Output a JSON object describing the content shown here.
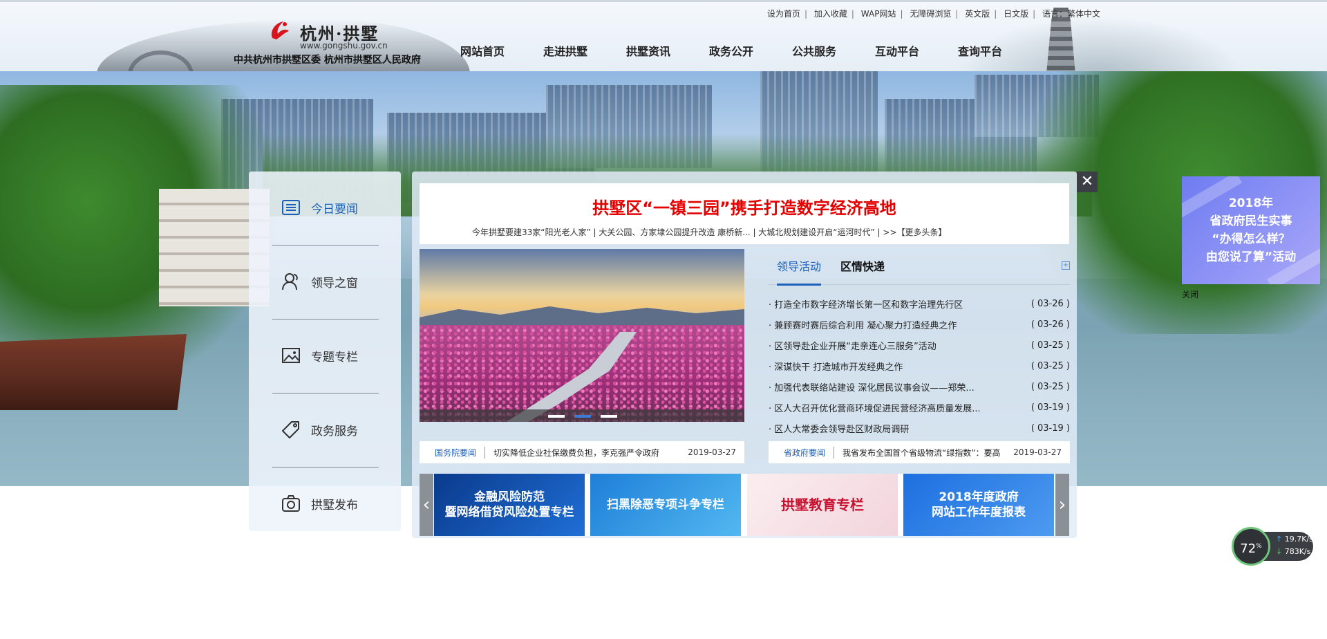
{
  "logo": {
    "title": "杭州·拱墅",
    "url": "www.gongshu.gov.cn",
    "org": "中共杭州市拱墅区委  杭州市拱墅区人民政府"
  },
  "toplinks": [
    "设为首页",
    "加入收藏",
    "WAP网站",
    "无障碍浏览",
    "英文版",
    "日文版",
    "语言：繁体中文"
  ],
  "nav": [
    "网站首页",
    "走进拱墅",
    "拱墅资讯",
    "政务公开",
    "公共服务",
    "互动平台",
    "查询平台"
  ],
  "sidebar": {
    "items": [
      {
        "label": "今日要闻",
        "icon": "news-list-icon"
      },
      {
        "label": "领导之窗",
        "icon": "people-icon"
      },
      {
        "label": "专题专栏",
        "icon": "image-icon"
      },
      {
        "label": "政务服务",
        "icon": "tag-icon"
      },
      {
        "label": "拱墅发布",
        "icon": "camera-icon"
      }
    ]
  },
  "headline": {
    "title": "拱墅区“一镇三园”携手打造数字经济高地",
    "subnews": "今年拱墅要建33家“阳光老人家”  | 大关公园、方家埭公园提升改造 康桥新...  | 大城北规划建设开启“运河时代”  | >>【更多头条】"
  },
  "tabs": {
    "active": "领导活动",
    "other": "区情快递"
  },
  "news": [
    {
      "title": "· 打造全市数字经济增长第一区和数字治理先行区",
      "date": "( 03-26 )"
    },
    {
      "title": "· 兼顾赛时赛后综合利用 凝心聚力打造经典之作",
      "date": "( 03-26 )"
    },
    {
      "title": "· 区领导赴企业开展“走亲连心三服务”活动",
      "date": "( 03-25 )"
    },
    {
      "title": "· 深谋快干 打造城市开发经典之作",
      "date": "( 03-25 )"
    },
    {
      "title": "· 加强代表联络站建设 深化居民议事会议——郑荣...",
      "date": "( 03-25 )"
    },
    {
      "title": "· 区人大召开优化营商环境促进民营经济高质量发展...",
      "date": "( 03-19 )"
    },
    {
      "title": "· 区人大常委会领导赴区财政局调研",
      "date": "( 03-19 )"
    }
  ],
  "tickers": [
    {
      "source": "国务院要闻",
      "text": "切实降低企业社保缴费负担，李克强严令政府",
      "date": "2019-03-27"
    },
    {
      "source": "省政府要闻",
      "text": "我省发布全国首个省级物流“绿指数”：要高",
      "date": "2019-03-27"
    }
  ],
  "promos": [
    {
      "line1": "金融风险防范",
      "line2": "暨网络借贷风险处置专栏"
    },
    {
      "line1": "扫黑除恶专项斗争专栏",
      "line2": ""
    },
    {
      "line1": "拱墅教育专栏",
      "line2": ""
    },
    {
      "line1": "2018年度政府",
      "line2": "网站工作年度报表"
    }
  ],
  "ad": {
    "lines": [
      "2018年",
      "省政府民生实事",
      "“办得怎么样？",
      "由您说了算”活动"
    ],
    "close": "关闭"
  },
  "close_symbol": "✕",
  "network": {
    "percent": "72",
    "percent_unit": "%",
    "up": "19.7",
    "down": "783",
    "unit": "K/s"
  },
  "colors": {
    "accent": "#1c5fb8",
    "headline": "#e50000"
  }
}
